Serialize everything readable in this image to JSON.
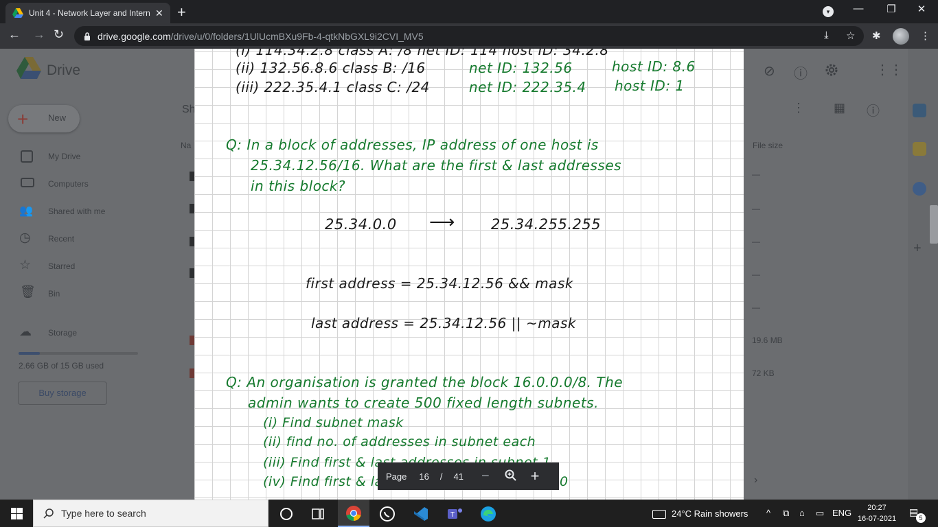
{
  "browser": {
    "tab_title": "Unit 4 - Network Layer and Intern",
    "url_host": "drive.google.com",
    "url_path": "/drive/u/0/folders/1UlUcmBXu9Fb-4-qtkNbGXL9i2CVI_MV5"
  },
  "drive": {
    "app_name": "Drive",
    "new_label": "New",
    "shared_heading": "Sh",
    "column_name": "Na",
    "column_file_size": "File size",
    "sidebar": [
      "My Drive",
      "Computers",
      "Shared with me",
      "Recent",
      "Starred",
      "Bin"
    ],
    "storage_label": "Storage",
    "storage_used": "2.66 GB of 15 GB used",
    "storage_fraction": 0.177,
    "buy_storage": "Buy storage",
    "sizes": [
      "—",
      "—",
      "—",
      "—",
      "—",
      "—",
      "—",
      "19.6 MB",
      "72 KB"
    ]
  },
  "document": {
    "lines": [
      {
        "text": "(i) 114.34.2.8   class A: /8     net ID: 114        host ID: 34.2.8",
        "color": "b"
      },
      {
        "text": "(ii) 132.56.8.6  class B: /16",
        "color": "b"
      },
      {
        "text": "net ID: 132.56",
        "color": "g"
      },
      {
        "text": "host ID: 8.6",
        "color": "g"
      },
      {
        "text": "(iii) 222.35.4.1 class C: /24",
        "color": "b"
      },
      {
        "text": "net ID: 222.35.4",
        "color": "g"
      },
      {
        "text": "host ID: 1",
        "color": "g"
      }
    ],
    "q1_lines": [
      "Q: In a block of addresses, IP address of one host is",
      "25.34.12.56/16. What are the first & last addresses",
      "in this block?"
    ],
    "range_first": "25.34.0.0",
    "range_arrow": "⟶",
    "range_last": "25.34.255.255",
    "first_address_line": "first address = 25.34.12.56 && mask",
    "last_address_line": "last address = 25.34.12.56 || ~mask",
    "q2_lines": [
      "Q: An organisation is granted the block 16.0.0.0/8. The",
      "admin wants to create 500 fixed length subnets.",
      "(i) Find subnet mask",
      "(ii) find no. of addresses in subnet each",
      "(iii) Find first & last addresses in subnet 1",
      "(iv) Find first & last addresses in subnet 500"
    ]
  },
  "viewer": {
    "page_label": "Page",
    "current_page": "16",
    "separator": "/",
    "total_pages": "41",
    "zoom_out": "−",
    "zoom_in": "+"
  },
  "taskbar": {
    "search_placeholder": "Type here to search",
    "weather": "24°C  Rain showers",
    "language": "ENG",
    "time": "20:27",
    "date": "16-07-2021",
    "notifications": "5"
  },
  "colors": {
    "ink_black": "#1a1a1a",
    "ink_green": "#167a2e"
  }
}
